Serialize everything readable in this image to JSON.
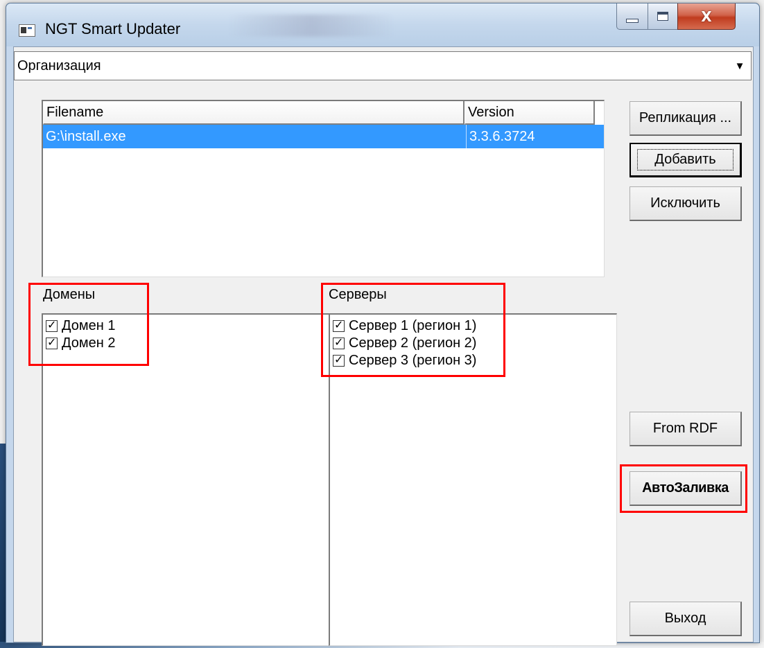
{
  "window": {
    "title": "NGT Smart Updater",
    "controls": {
      "minimize": "minimize",
      "maximize": "maximize",
      "close": "X"
    }
  },
  "organization_select": {
    "value": "Организация",
    "arrow": "▼"
  },
  "file_list": {
    "columns": [
      "Filename",
      "Version"
    ],
    "rows": [
      {
        "filename": "G:\\install.exe",
        "version": "3.3.6.3724",
        "selected": true
      }
    ]
  },
  "buttons": {
    "replication": "Репликация ...",
    "add": "Добавить",
    "exclude": "Исключить",
    "from_rdf": "From RDF",
    "autofill": "АвтоЗаливка",
    "exit": "Выход"
  },
  "domains": {
    "label": "Домены",
    "items": [
      {
        "label": "Домен 1",
        "checked": true
      },
      {
        "label": "Домен 2",
        "checked": true
      }
    ]
  },
  "servers": {
    "label": "Серверы",
    "items": [
      {
        "label": "Сервер 1 (регион 1)",
        "checked": true
      },
      {
        "label": "Сервер 2 (регион 2)",
        "checked": true
      },
      {
        "label": "Сервер 3 (регион 3)",
        "checked": true
      }
    ]
  },
  "annotation_color": "#ff0000",
  "selection_color": "#3399ff"
}
